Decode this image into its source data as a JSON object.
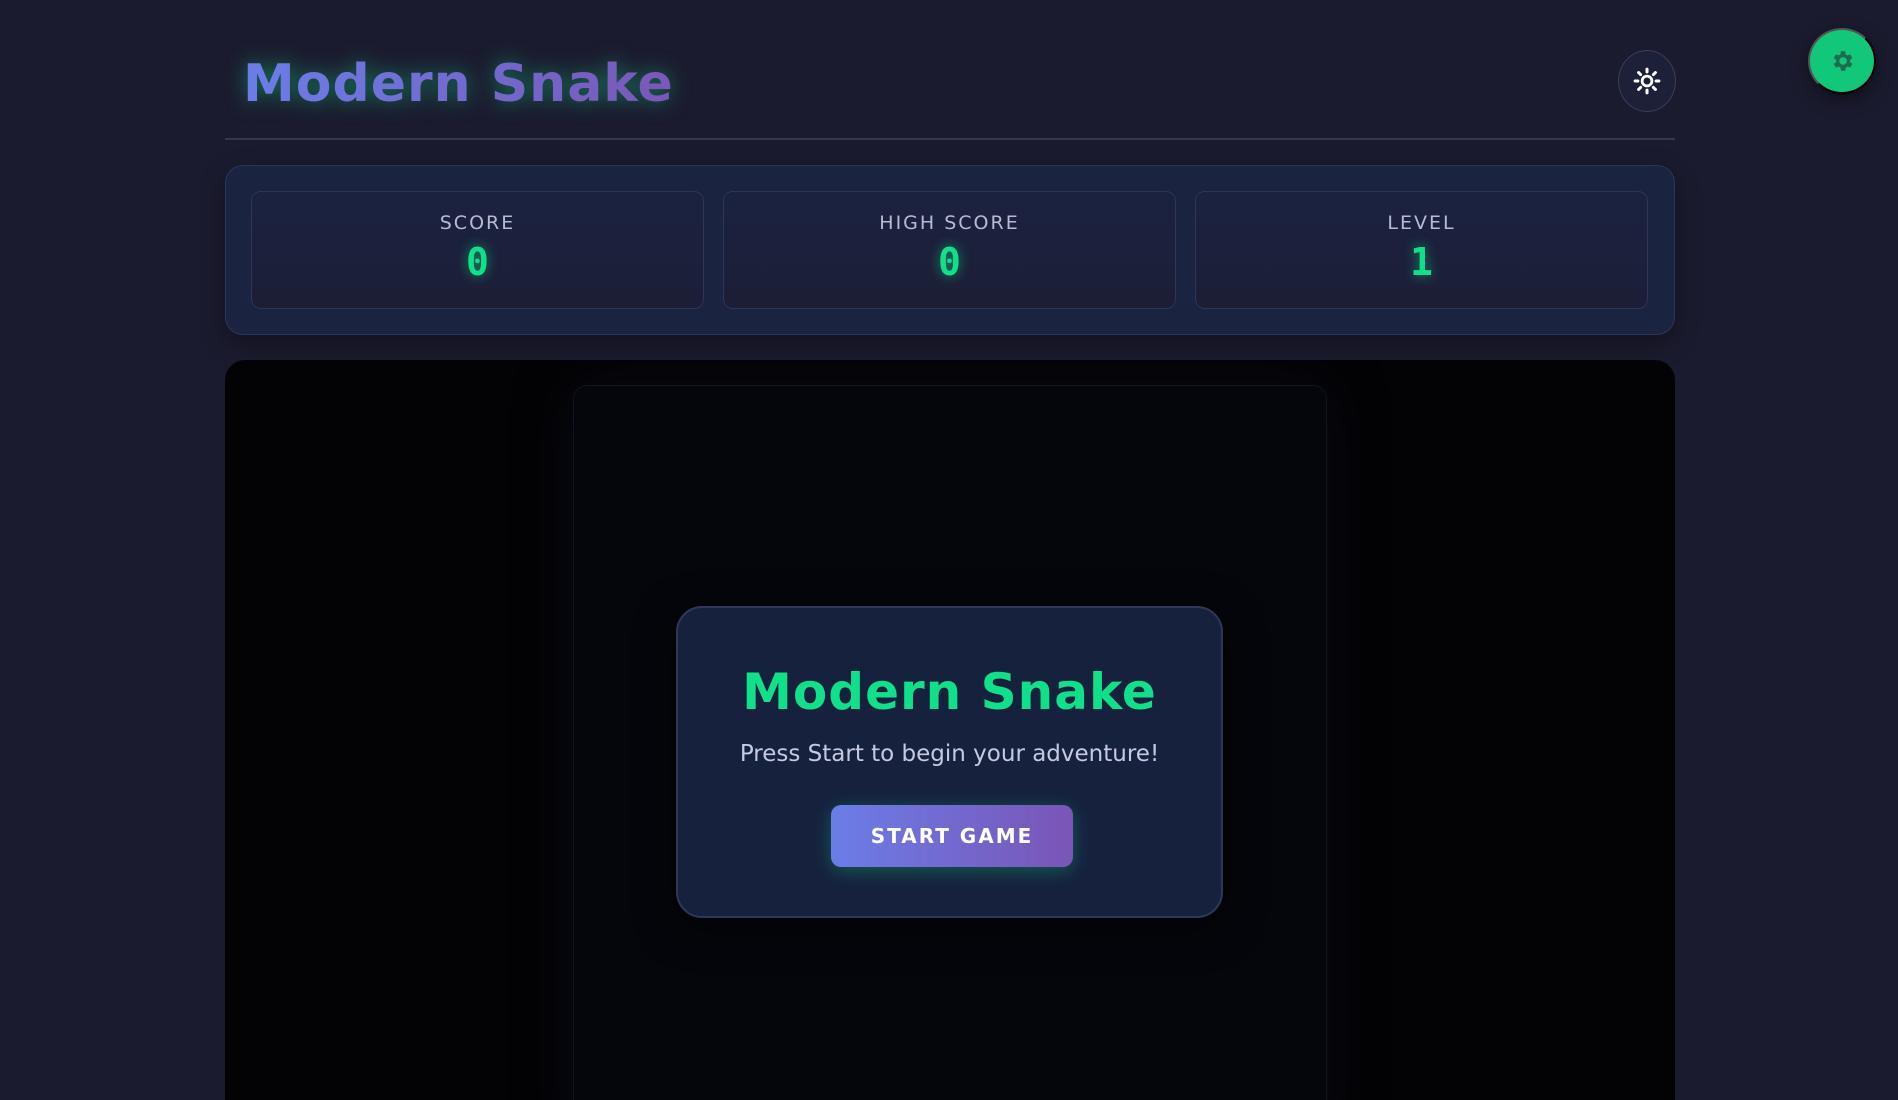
{
  "header": {
    "title": "Modern Snake",
    "theme_toggle_icon": "sun-icon"
  },
  "settings": {
    "icon": "gear-icon",
    "accent_color": "#10c77a"
  },
  "stats": [
    {
      "label": "SCORE",
      "value": "0"
    },
    {
      "label": "HIGH SCORE",
      "value": "0"
    },
    {
      "label": "LEVEL",
      "value": "1"
    }
  ],
  "start_screen": {
    "title": "Modern Snake",
    "subtitle": "Press Start to begin your adventure!",
    "button_label": "START GAME"
  },
  "colors": {
    "background": "#1b1b2f",
    "panel": "#1a2340",
    "accent_green": "#10e08a",
    "gradient_start": "#6b7de8",
    "gradient_end": "#7a55b6"
  }
}
